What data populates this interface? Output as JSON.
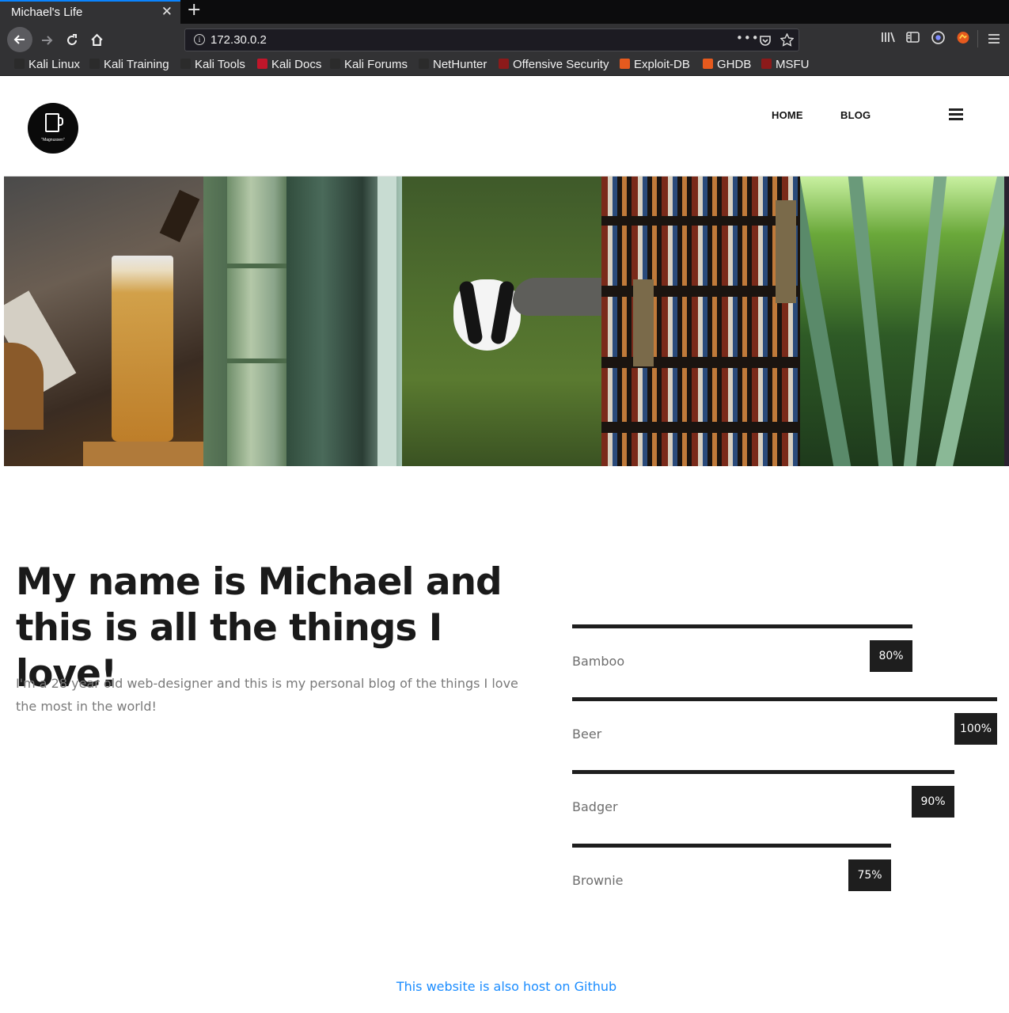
{
  "browser": {
    "tab_title": "Michael's Life",
    "tab_close": "✕",
    "new_tab": "+",
    "url": "172.30.0.2",
    "bookmarks": [
      {
        "label": "Kali Linux",
        "color": "#2b2b2b"
      },
      {
        "label": "Kali Training",
        "color": "#2b2b2b"
      },
      {
        "label": "Kali Tools",
        "color": "#2b2b2b"
      },
      {
        "label": "Kali Docs",
        "color": "#c0162a"
      },
      {
        "label": "Kali Forums",
        "color": "#2b2b2b"
      },
      {
        "label": "NetHunter",
        "color": "#2b2b2b"
      },
      {
        "label": "Offensive Security",
        "color": "#8b1a1a"
      },
      {
        "label": "Exploit-DB",
        "color": "#e65a1e"
      },
      {
        "label": "GHDB",
        "color": "#e65a1e"
      },
      {
        "label": "MSFU",
        "color": "#8b1a1a"
      }
    ]
  },
  "site": {
    "logo_text": "\"Magnussen\"",
    "nav": {
      "home": "HOME",
      "blog": "BLOG"
    },
    "headline": "My name is Michael and this is all the things I love!",
    "intro": "I'm a 28 year old web-designer and this is my personal blog of the things I love the most in the world!",
    "skills": [
      {
        "name": "Bamboo",
        "percent_label": "80%",
        "value": 80
      },
      {
        "name": "Beer",
        "percent_label": "100%",
        "value": 100
      },
      {
        "name": "Badger",
        "percent_label": "90%",
        "value": 90
      },
      {
        "name": "Brownie",
        "percent_label": "75%",
        "value": 75
      }
    ],
    "footer_link": "This website is also host on Github"
  },
  "colors": {
    "accent": "#0a84ff",
    "link": "#1a8cff",
    "dark": "#1e1e1e"
  }
}
